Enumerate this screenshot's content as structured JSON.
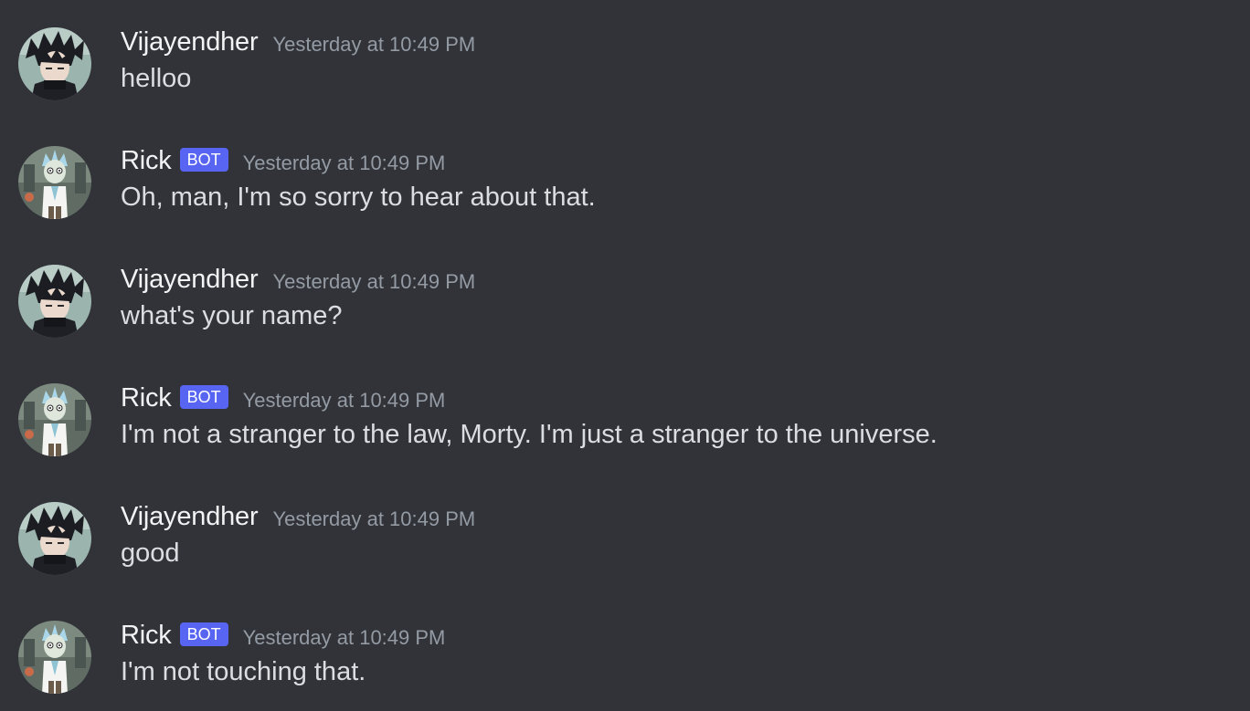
{
  "messages": [
    {
      "username": "Vijayendher",
      "bot": false,
      "badge": "",
      "timestamp": "Yesterday at 10:49 PM",
      "content": "helloo"
    },
    {
      "username": "Rick",
      "bot": true,
      "badge": "BOT",
      "timestamp": "Yesterday at 10:49 PM",
      "content": "Oh, man, I'm so sorry to hear about that."
    },
    {
      "username": "Vijayendher",
      "bot": false,
      "badge": "",
      "timestamp": "Yesterday at 10:49 PM",
      "content": "what's your name?"
    },
    {
      "username": "Rick",
      "bot": true,
      "badge": "BOT",
      "timestamp": "Yesterday at 10:49 PM",
      "content": "I'm not a stranger to the law, Morty. I'm just a stranger to the universe."
    },
    {
      "username": "Vijayendher",
      "bot": false,
      "badge": "",
      "timestamp": "Yesterday at 10:49 PM",
      "content": "good"
    },
    {
      "username": "Rick",
      "bot": true,
      "badge": "BOT",
      "timestamp": "Yesterday at 10:49 PM",
      "content": "I'm not touching that."
    }
  ],
  "colors": {
    "background": "#313338",
    "username": "#f2f3f5",
    "message_text": "#dbdee1",
    "timestamp": "#949ba4",
    "bot_badge": "#5865f2"
  },
  "icons": {
    "user_avatar": "anime-boy-avatar-icon",
    "bot_avatar": "rick-avatar-icon"
  }
}
